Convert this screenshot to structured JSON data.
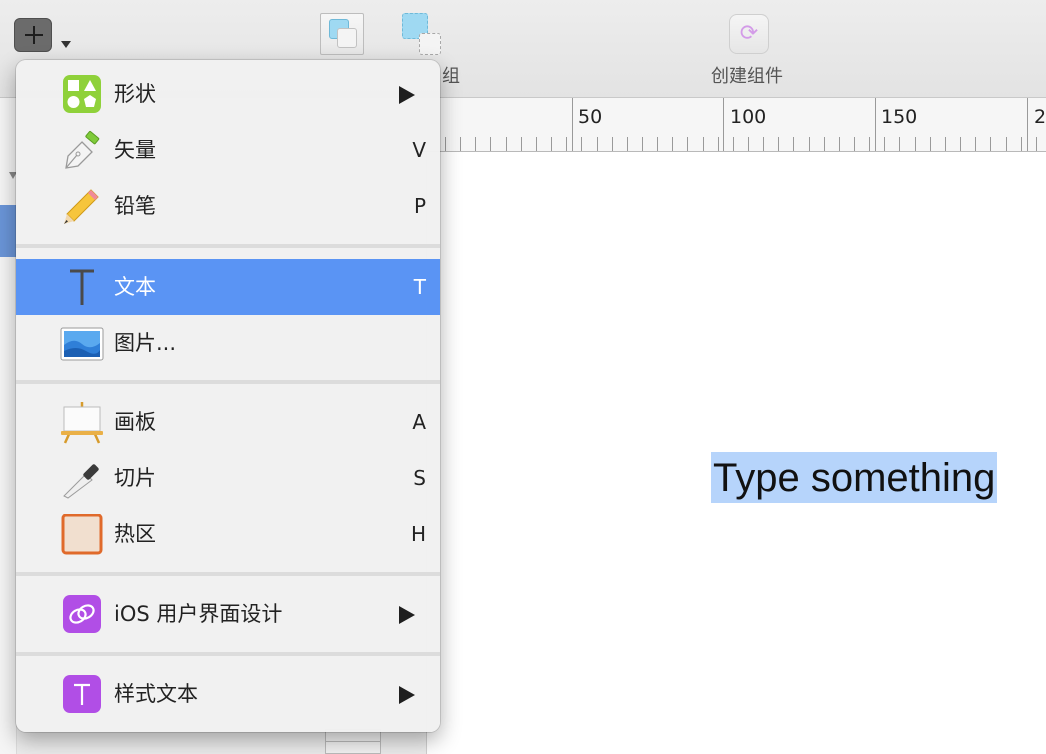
{
  "toolbar": {
    "insert_button": "insert",
    "group_label": "组",
    "create_component_label": "创建组件"
  },
  "ruler": {
    "labels": [
      "50",
      "100",
      "150",
      "2"
    ]
  },
  "canvas": {
    "selected_text": "Type something"
  },
  "menu": {
    "shape": {
      "label": "形状",
      "icon": "shapes-icon"
    },
    "vector": {
      "label": "矢量",
      "shortcut": "V",
      "icon": "pen-icon"
    },
    "pencil": {
      "label": "铅笔",
      "shortcut": "P",
      "icon": "pencil-icon"
    },
    "text": {
      "label": "文本",
      "shortcut": "T",
      "icon": "text-cursor-icon"
    },
    "image": {
      "label": "图片...",
      "icon": "image-icon"
    },
    "artboard": {
      "label": "画板",
      "shortcut": "A",
      "icon": "easel-icon"
    },
    "slice": {
      "label": "切片",
      "shortcut": "S",
      "icon": "knife-icon"
    },
    "hotspot": {
      "label": "热区",
      "shortcut": "H",
      "icon": "hotspot-icon"
    },
    "ios_ui": {
      "label": "iOS 用户界面设计",
      "icon": "symbol-link-icon"
    },
    "text_styles": {
      "label": "样式文本",
      "icon": "text-style-icon"
    }
  },
  "colors": {
    "menu_highlight": "#5a94f4",
    "text_selection": "#b6d4fb",
    "purple_icon": "#b14ee6",
    "green_icon": "#8fd13a"
  }
}
